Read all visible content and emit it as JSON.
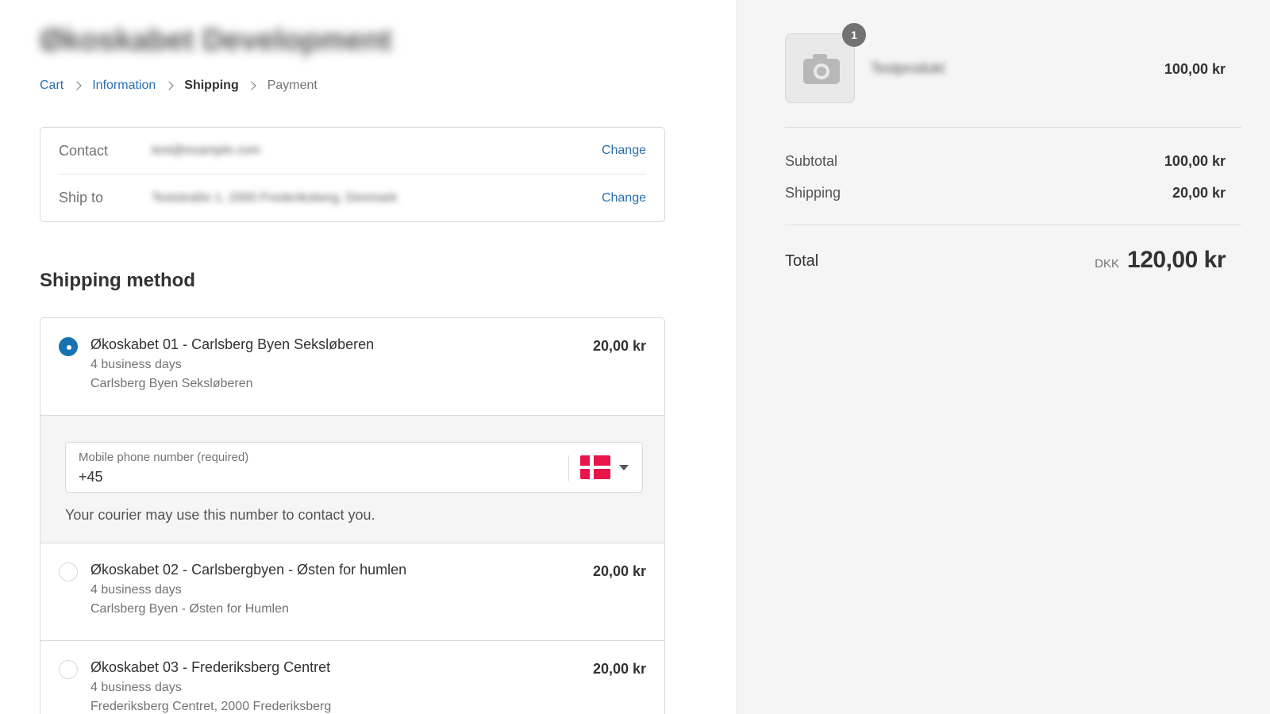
{
  "shop": {
    "name": "Økoskabet Development"
  },
  "breadcrumb": [
    {
      "label": "Cart"
    },
    {
      "label": "Information"
    },
    {
      "label": "Shipping"
    },
    {
      "label": "Payment"
    }
  ],
  "review": {
    "contact": {
      "label": "Contact",
      "value": "test@example.com",
      "action": "Change"
    },
    "ship_to": {
      "label": "Ship to",
      "value": "Teststraße 1, 2000 Frederiksberg, Denmark",
      "action": "Change"
    }
  },
  "shipping_method": {
    "title": "Shipping method",
    "options": [
      {
        "name": "Økoskabet 01 - Carlsberg Byen Seksløberen",
        "price": "20,00 kr",
        "eta": "4 business days",
        "location": "Carlsberg Byen Seksløberen",
        "selected": true
      },
      {
        "name": "Økoskabet 02 - Carlsbergbyen - Østen for humlen",
        "price": "20,00 kr",
        "eta": "4 business days",
        "location": "Carlsberg Byen - Østen for Humlen",
        "selected": false
      },
      {
        "name": "Økoskabet 03 - Frederiksberg Centret",
        "price": "20,00 kr",
        "eta": "4 business days",
        "location": "Frederiksberg Centret, 2000 Frederiksberg",
        "selected": false
      }
    ],
    "phone": {
      "label": "Mobile phone number (required)",
      "value": "+45",
      "country_flag_icon": "denmark-flag-icon",
      "help": "Your courier may use this number to contact you."
    }
  },
  "summary": {
    "item": {
      "quantity": "1",
      "name": "Testprodukt",
      "price": "100,00 kr",
      "image_icon": "camera-icon"
    },
    "subtotal": {
      "label": "Subtotal",
      "value": "100,00 kr"
    },
    "shipping": {
      "label": "Shipping",
      "value": "20,00 kr"
    },
    "total": {
      "label": "Total",
      "currency": "DKK",
      "value": "120,00 kr"
    }
  },
  "colors": {
    "link": "#2a6fb0",
    "radio_selected": "#1773b0",
    "summary_bg": "#f5f5f5",
    "flag_red": "#e8144a"
  }
}
